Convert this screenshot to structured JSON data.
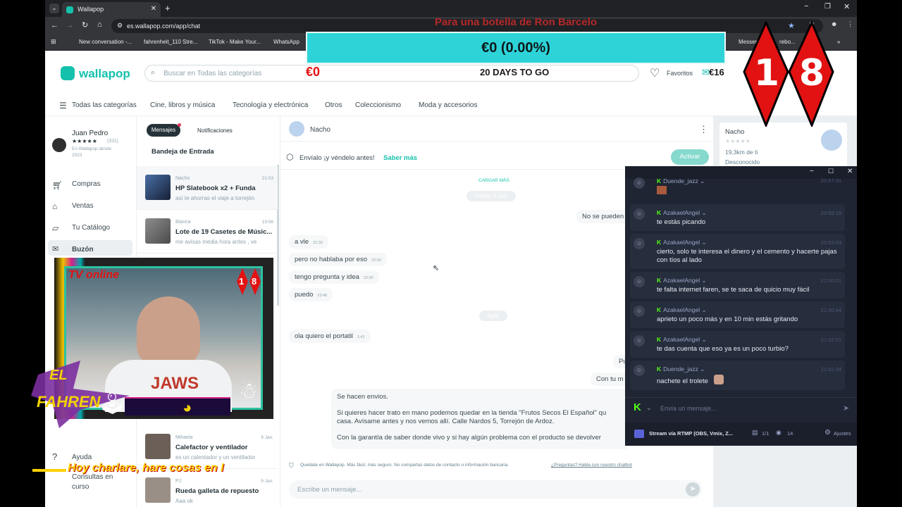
{
  "browser": {
    "tab_title": "Wallapop",
    "url": "es.wallapop.com/app/chat",
    "bookmarks": [
      "New conversation -...",
      "fahrenheit_110 Stre...",
      "TikTok - Make Your...",
      "WhatsApp",
      "Messer",
      "rebo..."
    ]
  },
  "stream_overlay": {
    "banner_title": "Para una botella de Ron Barcelo",
    "goal_amount": "€0 (0.00%)",
    "left_amount": "€0",
    "countdown": "20 DAYS TO GO",
    "target_amount": "€16",
    "badge_digit_1": "1",
    "badge_digit_2": "8",
    "cam_live_text": "TV online",
    "cam_badge_1": "1",
    "cam_badge_2": "8",
    "logo_line_1": "EL",
    "logo_line_2": "FAHREN",
    "ticker": "Hoy charlare, hare cosas en I"
  },
  "header": {
    "logo": "wallapop",
    "search_placeholder": "Buscar en Todas las categorías",
    "favorites": "Favoritos",
    "messages": "Buzón"
  },
  "categories": [
    "Todas las categorías",
    "Cine, libros y música",
    "Tecnología y electrónica",
    "Otros",
    "Coleccionismo",
    "Moda y accesorios"
  ],
  "profile": {
    "name": "Juan Pedro",
    "stars": "★★★★★",
    "rating_count": "(311)",
    "since_line1": "En Wallapop desde",
    "since_line2": "2023"
  },
  "sidebar": {
    "items": [
      "Compras",
      "Ventas",
      "Tu Catálogo",
      "Buzón"
    ],
    "help": "Ayuda",
    "consultas_1": "Consultas en",
    "consultas_2": "curso"
  },
  "inbox": {
    "tab_messages": "Mensajes",
    "tab_notifications": "Notificaciones",
    "heading": "Bandeja de Entrada",
    "conversations": [
      {
        "from": "Nacho",
        "time": "21:03",
        "title": "HP Slatebook x2 + Funda",
        "snippet": "así te ahorras el viaje a torrejón"
      },
      {
        "from": "Bianca",
        "time": "19:56",
        "title": "Lote de 19 Casetes de Músic...",
        "snippet": "me avisas media hora antes , ve"
      },
      {
        "from": "Mihaela",
        "time": "9 Jan.",
        "title": "Calefactor y ventilador",
        "snippet": "es un calentador y un ventilador"
      },
      {
        "from": "PJ",
        "time": "9 Jan.",
        "title": "Rueda galleta de repuesto",
        "snippet": "Aaa ok"
      }
    ]
  },
  "chat": {
    "contact": "Nacho",
    "promo_text": "Envíalo ¡y véndelo antes!",
    "promo_link": "Saber más",
    "promo_button": "Activar",
    "load_more": "CARGAR MÁS",
    "day1": "Friday, 9 Jan",
    "no_se_pueden": "No se pueden",
    "messages": [
      {
        "text": "a vle",
        "time": "22:30"
      },
      {
        "text": "pero no hablaba por eso",
        "time": "22:30"
      },
      {
        "text": "tengo pregunta y idea",
        "time": "22:30"
      },
      {
        "text": "puedo",
        "time": "23:46"
      }
    ],
    "day2": "Ayer",
    "message_after": {
      "text": "ola quiero el portatil",
      "time": "1:41"
    },
    "partial_1": "Pu",
    "partial_2": "Con tu m",
    "seller_line1": "Se hacen envios.",
    "seller_line2": "Si quieres hacer trato en mano podemos quedar en la tienda \"Frutos Secos El Español\" qu",
    "seller_line3": "casa. Avísame antes y nos vemos allí. Calle Nardos 5, Torrejón de Ardoz.",
    "seller_line4": "Con la garantía de saber donde vivo y si hay algún problema con el producto se devolver",
    "safety_note": "Quédate en Wallapop. Más fácil, más seguro. No compartas datos de contacto o información bancaria.",
    "safety_link": "¿Preguntas? Habla con nuestro chatbot",
    "input_placeholder": "Escribe un mensaje..."
  },
  "contact_panel": {
    "name": "Nacho",
    "distance": "19,3km de ti",
    "status": "Desconocido"
  },
  "stream_chat": {
    "messages": [
      {
        "user": "Duende_jazz",
        "time": "20:57:31",
        "text": ""
      },
      {
        "user": "AzakaelAngel",
        "time": "20:58:19",
        "text": "te estás picando"
      },
      {
        "user": "AzakaelAngel",
        "time": "20:59:03",
        "text": "cierto, solo te interesa el dinero y el cemento y hacerte pajas con tíos al lado"
      },
      {
        "user": "AzakaelAngel",
        "time": "21:00:01",
        "text": "te falta internet faren, se te saca de quicio muy fácil"
      },
      {
        "user": "AzakaelAngel",
        "time": "21:00:44",
        "text": "aprieto un poco más y en 10 min estás gritando"
      },
      {
        "user": "AzakaelAngel",
        "time": "21:02:01",
        "text": "te das cuenta que eso ya es un poco turbio?"
      },
      {
        "user": "Duende_jazz",
        "time": "21:02:34",
        "text": "nachete el trolete"
      }
    ],
    "input_placeholder": "Envía un mensaje...",
    "footer_stream": "Stream vía RTMP (OBS, Vmix, Z...",
    "footer_count": "1/1",
    "footer_viewers": "14",
    "footer_settings": "Ajustes"
  },
  "colors": {
    "brand": "#13c1ac",
    "chat_bg": "#1f2533",
    "kick_green": "#53fc18",
    "goal_cyan": "#2ed3d8",
    "badge_red": "#e21212"
  }
}
